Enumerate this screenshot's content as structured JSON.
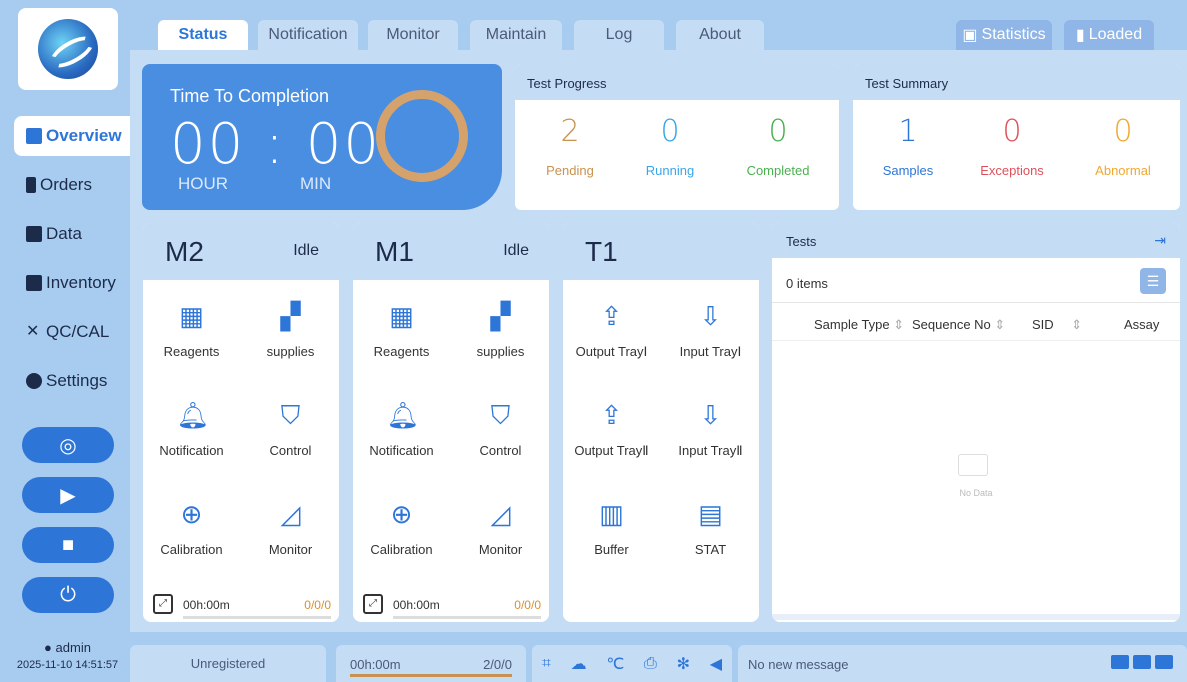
{
  "tabs": [
    "Status",
    "Notification",
    "Monitor",
    "Maintain",
    "Log",
    "About"
  ],
  "right_tabs": [
    "Statistics",
    "Loaded"
  ],
  "sidebar": {
    "items": [
      {
        "label": "Overview",
        "icon": "monitor-icon"
      },
      {
        "label": "Orders",
        "icon": "tube-icon"
      },
      {
        "label": "Data",
        "icon": "chart-icon"
      },
      {
        "label": "Inventory",
        "icon": "boxes-icon"
      },
      {
        "label": "QC/CAL",
        "icon": "tools-icon"
      },
      {
        "label": "Settings",
        "icon": "gear-icon"
      }
    ],
    "user": "admin",
    "datetime": "2025-11-10 14:51:57"
  },
  "time_panel": {
    "label": "Time  To  Completion",
    "value": "00 : 00",
    "hour": "HOUR",
    "min": "MIN"
  },
  "test_progress": {
    "title": "Test Progress",
    "stats": [
      {
        "num": "2",
        "label": "Pending",
        "color": "#c9914f"
      },
      {
        "num": "0",
        "label": "Running",
        "color": "#3aa6e8"
      },
      {
        "num": "0",
        "label": "Completed",
        "color": "#4caf50"
      }
    ]
  },
  "test_summary": {
    "title": "Test Summary",
    "stats": [
      {
        "num": "1",
        "label": "Samples",
        "color": "#2d76d8"
      },
      {
        "num": "0",
        "label": "Exceptions",
        "color": "#e0505a"
      },
      {
        "num": "0",
        "label": "Abnormal",
        "color": "#f0a830"
      }
    ]
  },
  "modules": [
    {
      "name": "M2",
      "state": "Idle",
      "time": "00h:00m",
      "count": "0/0/0",
      "cells": [
        "Reagents",
        "supplies",
        "Notification",
        "Control",
        "Calibration",
        "Monitor"
      ]
    },
    {
      "name": "M1",
      "state": "Idle",
      "time": "00h:00m",
      "count": "0/0/0",
      "cells": [
        "Reagents",
        "supplies",
        "Notification",
        "Control",
        "Calibration",
        "Monitor"
      ]
    },
    {
      "name": "T1",
      "state": "",
      "cells": [
        "Output TrayⅠ",
        "Input TrayⅠ",
        "Output TrayⅡ",
        "Input TrayⅡ",
        "Buffer",
        "STAT"
      ]
    }
  ],
  "tests": {
    "title": "Tests",
    "count": "0 items",
    "columns": [
      "Sample Type",
      "Sequence No",
      "SID",
      "Assay"
    ],
    "empty": "No Data"
  },
  "bottom": {
    "registration": "Unregistered",
    "time": "00h:00m",
    "count": "2/0/0",
    "message": "No new message"
  }
}
